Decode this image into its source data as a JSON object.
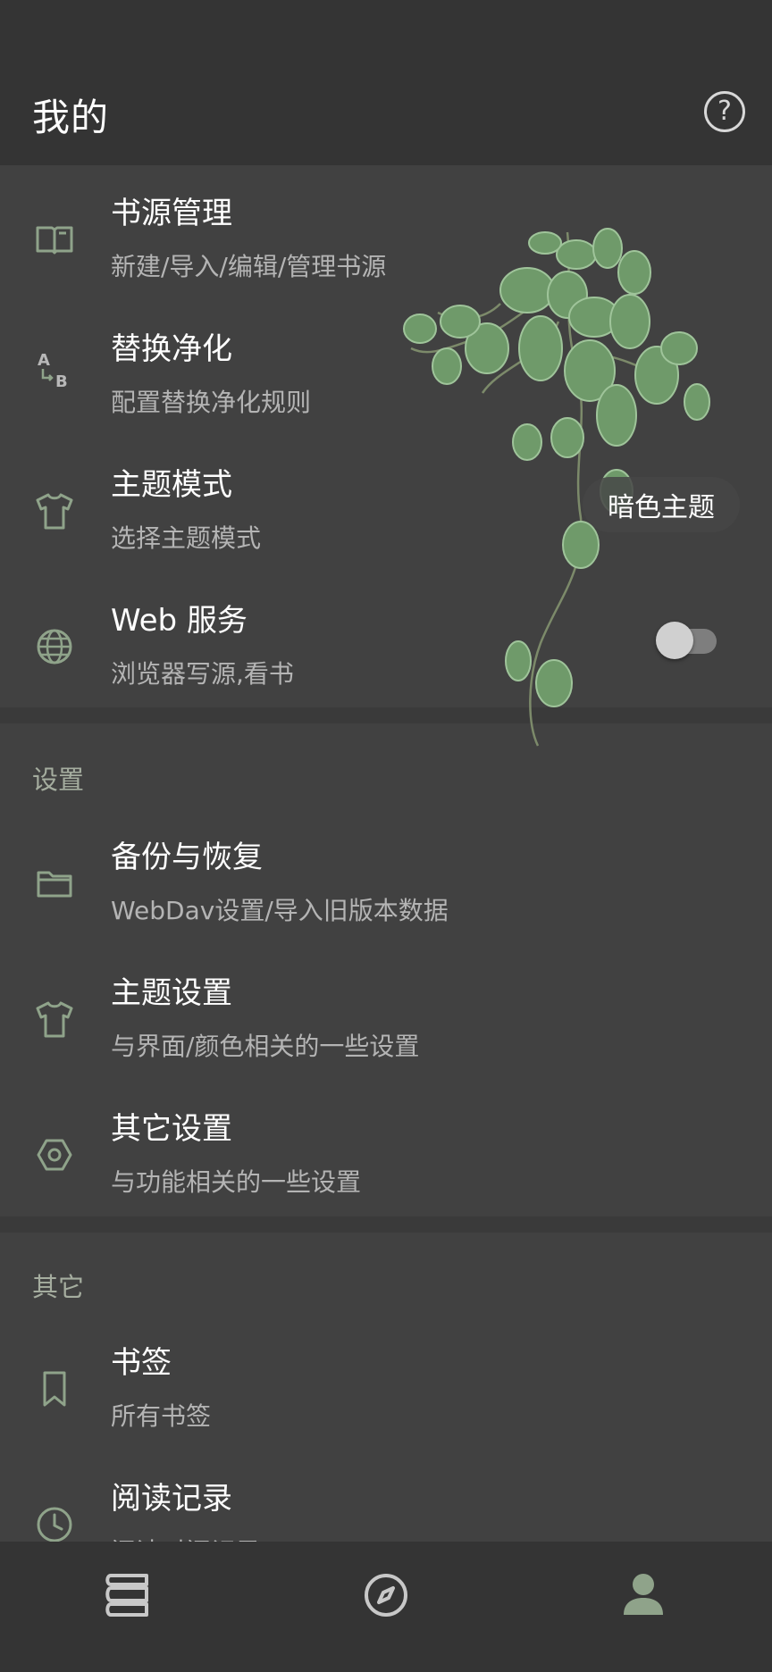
{
  "header": {
    "title": "我的",
    "help_icon": "help-circle-icon"
  },
  "main_items": [
    {
      "title": "书源管理",
      "subtitle": "新建/导入/编辑/管理书源",
      "icon": "book-open-icon"
    },
    {
      "title": "替换净化",
      "subtitle": "配置替换净化规则",
      "icon": "replace-ab-icon"
    },
    {
      "title": "主题模式",
      "subtitle": "选择主题模式",
      "icon": "tshirt-icon",
      "value": "暗色主题"
    },
    {
      "title": "Web 服务",
      "subtitle": "浏览器写源,看书",
      "icon": "globe-icon",
      "toggle_on": false
    }
  ],
  "settings": {
    "label": "设置",
    "items": [
      {
        "title": "备份与恢复",
        "subtitle": "WebDav设置/导入旧版本数据",
        "icon": "folder-icon"
      },
      {
        "title": "主题设置",
        "subtitle": "与界面/颜色相关的一些设置",
        "icon": "tshirt-icon"
      },
      {
        "title": "其它设置",
        "subtitle": "与功能相关的一些设置",
        "icon": "hex-nut-icon"
      }
    ]
  },
  "other": {
    "label": "其它",
    "items": [
      {
        "title": "书签",
        "subtitle": "所有书签",
        "icon": "bookmark-icon"
      },
      {
        "title": "阅读记录",
        "subtitle": "阅读时间记录",
        "icon": "clock-icon"
      }
    ]
  },
  "bottom_nav": [
    {
      "icon": "bookshelf-icon",
      "active": false
    },
    {
      "icon": "compass-icon",
      "active": false
    },
    {
      "icon": "person-icon",
      "active": true
    }
  ],
  "colors": {
    "background": "#414141",
    "header": "#343434",
    "icon_accent": "#8fa38a",
    "section_label": "#a5ad9f"
  }
}
